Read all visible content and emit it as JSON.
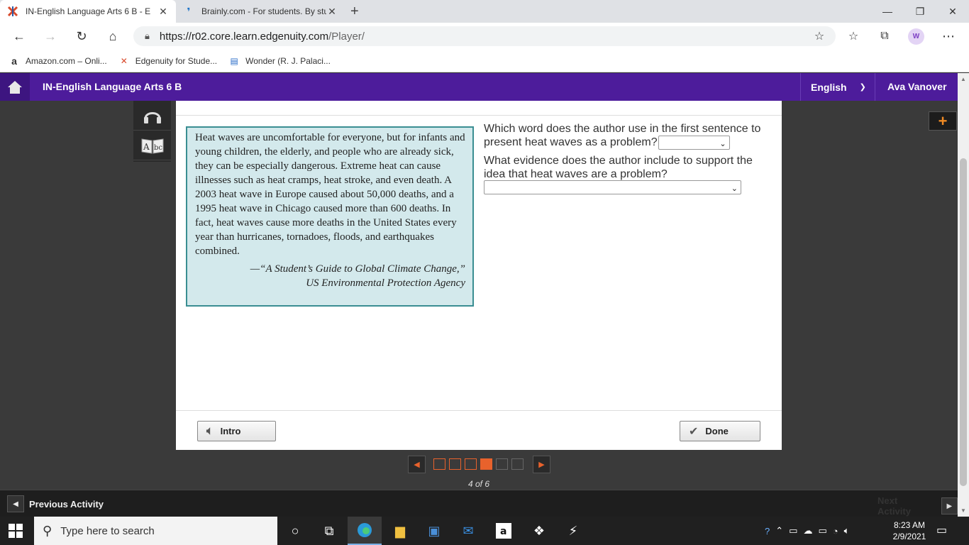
{
  "browser": {
    "tabs": [
      {
        "title": "IN-English Language Arts 6 B - E",
        "active": true
      },
      {
        "title": "Brainly.com - For students. By stu",
        "active": false
      }
    ],
    "url_host": "https://r02.core.learn.edgenuity.com",
    "url_path": "/Player/",
    "profile_initial": "W",
    "bookmarks": [
      {
        "label": "Amazon.com – Onli..."
      },
      {
        "label": "Edgenuity for Stude..."
      },
      {
        "label": "Wonder (R. J. Palaci..."
      }
    ]
  },
  "header": {
    "course_title": "IN-English Language Arts 6 B",
    "language": "English",
    "user_name": "Ava Vanover"
  },
  "passage": {
    "text": "Heat waves are uncomfortable for everyone, but for infants and young children, the elderly, and people who are already sick, they can be especially dangerous. Extreme heat can cause illnesses such as heat cramps, heat stroke, and even death. A 2003 heat wave in Europe caused about 50,000 deaths, and a 1995 heat wave in Chicago caused more than 600 deaths. In fact, heat waves cause more deaths in the United States every year than hurricanes, tornadoes, floods, and earthquakes combined.",
    "citation_line1": "—“A Student’s Guide to Global Climate Change,”",
    "citation_line2": "US Environmental Protection Agency"
  },
  "questions": {
    "q1": "Which word does the author use in the first sentence to present heat waves as a problem?",
    "q1_value": "",
    "q2": "What evidence does the author include to support the idea that heat waves are a problem?",
    "q2_value": ""
  },
  "footer": {
    "intro_label": "Intro",
    "done_label": "Done"
  },
  "pager": {
    "current": 4,
    "total": 6,
    "label": "4 of 6"
  },
  "activity_nav": {
    "previous_label": "Previous Activity",
    "next_label": "Next Activity"
  },
  "taskbar": {
    "search_placeholder": "Type here to search",
    "time": "8:23 AM",
    "date": "2/9/2021"
  },
  "colors": {
    "header_purple": "#4d1c9b",
    "passage_bg": "#d3e9ec",
    "passage_border": "#3a8e92",
    "accent_orange": "#e8622c"
  }
}
